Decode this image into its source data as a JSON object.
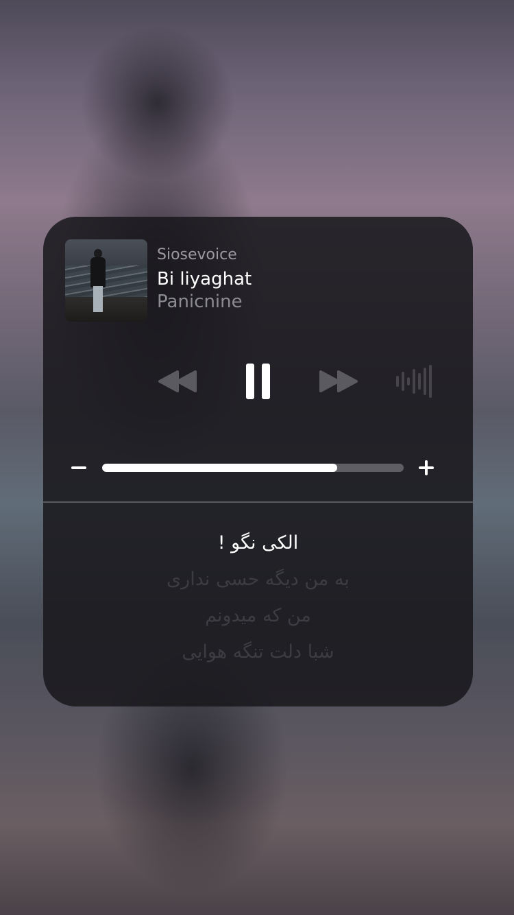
{
  "player": {
    "app_name": "Siosevoice",
    "track_title": "Bi liyaghat",
    "artist": "Panicnine",
    "volume_percent": 78
  },
  "controls": {
    "rewind_icon": "rewind-icon",
    "pause_icon": "pause-icon",
    "forward_icon": "fast-forward-icon",
    "output_icon": "audio-waveform-icon",
    "volume_down_icon": "minus-icon",
    "volume_up_icon": "plus-icon"
  },
  "lyrics": {
    "current": "الکی نگو !",
    "lines": [
      "به من دیگه حسی نداری",
      "من که میدونم",
      "شبا دلت تنگه هوایی"
    ]
  },
  "colors": {
    "card_bg": "#18171c",
    "text_primary": "#ffffff",
    "text_secondary": "#9b9aa1",
    "icon_dim": "#5b5a60",
    "track_empty": "#5f5e64"
  }
}
